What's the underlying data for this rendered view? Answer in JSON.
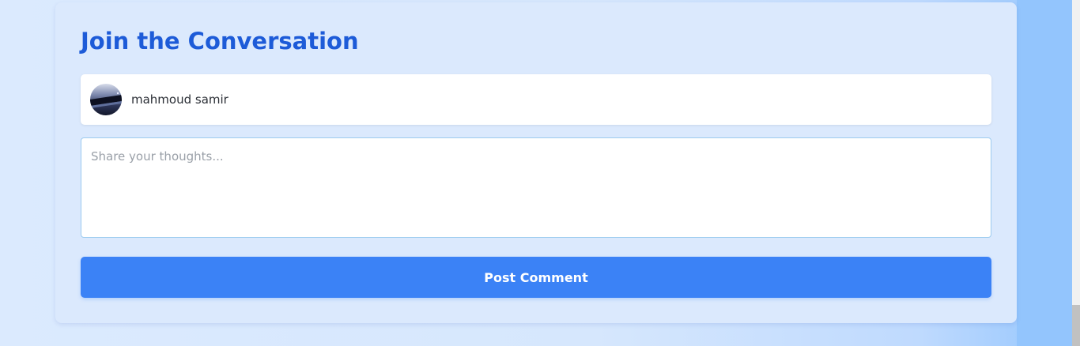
{
  "comment_section": {
    "title": "Join the Conversation",
    "user": {
      "name": "mahmoud samir",
      "avatar_icon": "user-avatar-photo"
    },
    "comment_field": {
      "placeholder": "Share your thoughts...",
      "value": ""
    },
    "submit_label": "Post Comment"
  },
  "colors": {
    "title": "#1d5bd8",
    "button": "#3b82f6",
    "card_background": "#dbe9fd",
    "page_background": "#dbeafe",
    "accent_strip": "#93c5fd"
  }
}
